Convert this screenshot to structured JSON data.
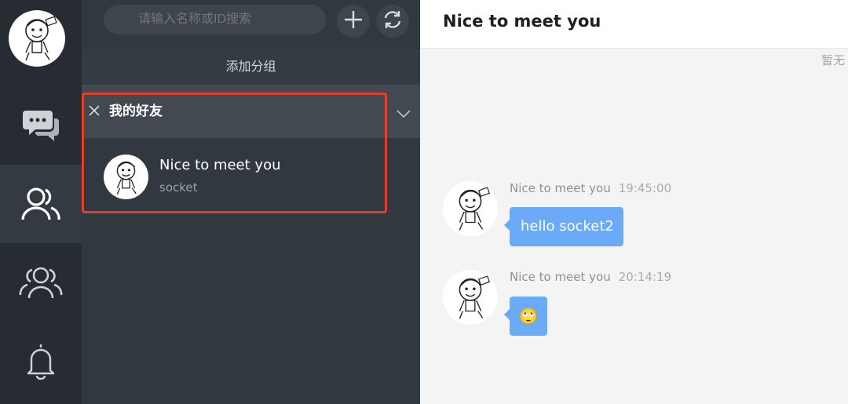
{
  "search": {
    "placeholder": "请输入名称或ID搜索"
  },
  "panel": {
    "add_group_label": "添加分组",
    "group": {
      "name": "我的好友",
      "friends": [
        {
          "name": "Nice to meet you",
          "subtitle": "socket"
        }
      ]
    }
  },
  "chat": {
    "title": "Nice to meet you",
    "no_more": "暂无",
    "messages": [
      {
        "sender": "Nice to meet you",
        "time": "19:45:00",
        "text": "hello socket2"
      },
      {
        "sender": "Nice to meet you",
        "time": "20:14:19",
        "text": "🙄"
      }
    ]
  },
  "colors": {
    "rail_bg": "#272c33",
    "panel_bg": "#323840",
    "bubble": "#6aaaf6",
    "highlight": "#e0412d"
  },
  "icons": [
    "chat-icon",
    "contacts-icon",
    "groups-icon",
    "bell-icon",
    "plus-icon",
    "refresh-icon",
    "close-icon",
    "chevron-down-icon"
  ]
}
